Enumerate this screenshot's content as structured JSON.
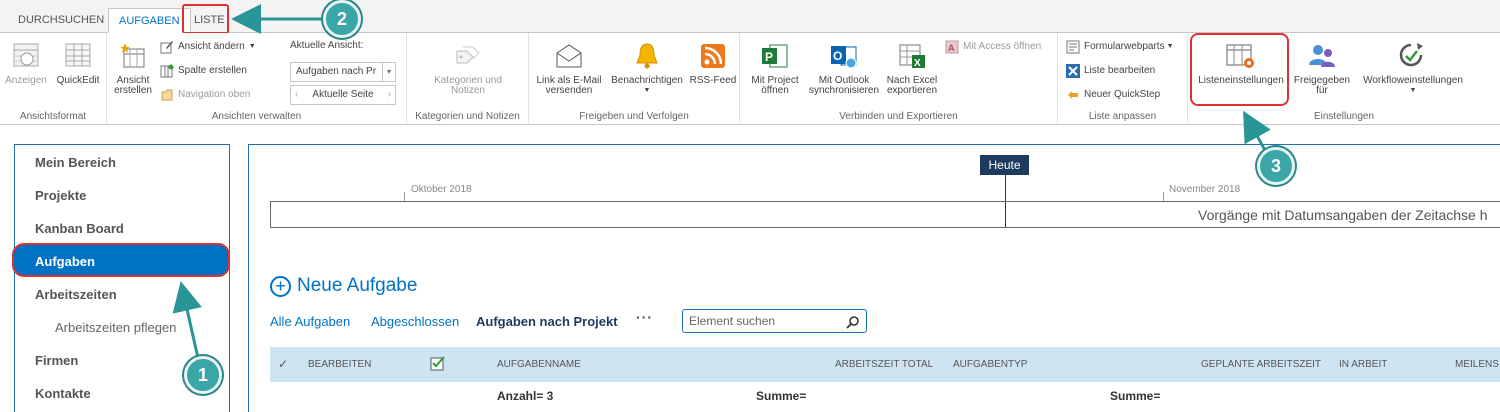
{
  "tabs": [
    {
      "label": "DURCHSUCHEN"
    },
    {
      "label": "AUFGABEN"
    },
    {
      "label": "LISTE"
    }
  ],
  "ribbon": {
    "groups": [
      {
        "label": "Ansichtsformat"
      },
      {
        "label": "Ansichten verwalten"
      },
      {
        "label": "Kategorien und Notizen"
      },
      {
        "label": "Freigeben und Verfolgen"
      },
      {
        "label": "Verbinden und Exportieren"
      },
      {
        "label": "Liste anpassen"
      },
      {
        "label": "Einstellungen"
      }
    ],
    "ansichtsformat": {
      "anzeigen": "Anzeigen",
      "quickedit": "QuickEdit"
    },
    "ansichten": {
      "erstellen": [
        "Ansicht",
        "erstellen"
      ],
      "aendern": "Ansicht ändern",
      "spalte": "Spalte erstellen",
      "navigation": "Navigation oben",
      "aktuelle_label": "Aktuelle Ansicht:",
      "aktuelle_value": "Aufgaben nach Pr",
      "seite": "Aktuelle Seite"
    },
    "kategorien": [
      "Kategorien und",
      "Notizen"
    ],
    "freigeben": {
      "email": [
        "Link als E-Mail",
        "versenden"
      ],
      "benachrichtigen": "Benachrichtigen",
      "rss": "RSS-Feed"
    },
    "verbinden": {
      "project": [
        "Mit Project",
        "öffnen"
      ],
      "outlook": [
        "Mit Outlook",
        "synchronisieren"
      ],
      "excel": [
        "Nach Excel",
        "exportieren"
      ],
      "access": "Mit Access öffnen"
    },
    "anpassen": {
      "formular": "Formularwebparts",
      "bearbeiten": "Liste bearbeiten",
      "quickstep": "Neuer QuickStep"
    },
    "einstellungen": {
      "liste": "Listeneinstellungen",
      "freigegeben": [
        "Freigegeben",
        "für"
      ],
      "workflow": "Workfloweinstellungen"
    }
  },
  "sidebar": {
    "items": [
      {
        "label": "Mein Bereich"
      },
      {
        "label": "Projekte"
      },
      {
        "label": "Kanban Board"
      },
      {
        "label": "Aufgaben"
      },
      {
        "label": "Arbeitszeiten"
      },
      {
        "label": "Arbeitszeiten pflegen"
      },
      {
        "label": "Firmen"
      },
      {
        "label": "Kontakte"
      }
    ]
  },
  "timeline": {
    "today": "Heute",
    "month1": "Oktober 2018",
    "month2": "November 2018",
    "placeholder": "Vorgänge mit Datumsangaben der Zeitachse h"
  },
  "main": {
    "new_task": "Neue Aufgabe",
    "views": [
      "Alle Aufgaben",
      "Abgeschlossen",
      "Aufgaben nach Projekt"
    ],
    "ellipsis": "···",
    "search_placeholder": "Element suchen",
    "columns": [
      "Bearbeiten",
      "Aufgabenname",
      "Arbeitszeit total",
      "Aufgabentyp",
      "Geplante Arbeitszeit",
      "In Arbeit",
      "Meilens"
    ],
    "sum_count": "Anzahl= 3",
    "sum1": "Summe=",
    "sum2": "Summe="
  },
  "callouts": [
    "1",
    "2",
    "3"
  ],
  "colors": {
    "accent": "#0072c6",
    "annotation": "#e03030",
    "callout": "#3aa6a8"
  }
}
